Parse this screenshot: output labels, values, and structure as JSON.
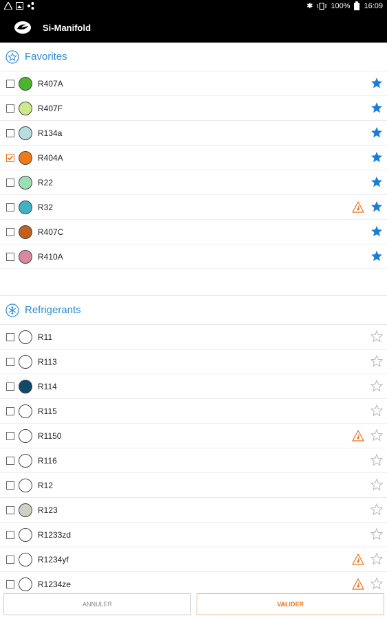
{
  "status": {
    "battery": "100%",
    "time": "16:09"
  },
  "app": {
    "title": "Si-Manifold"
  },
  "favorites": {
    "title": "Favorites",
    "items": [
      {
        "label": "R407A",
        "color": "#4db52d",
        "checked": false,
        "warning": false,
        "favorite": true
      },
      {
        "label": "R407F",
        "color": "#cde98b",
        "checked": false,
        "warning": false,
        "favorite": true
      },
      {
        "label": "R134a",
        "color": "#b9dce0",
        "checked": false,
        "warning": false,
        "favorite": true
      },
      {
        "label": "R404A",
        "color": "#ef7a17",
        "checked": true,
        "warning": false,
        "favorite": true
      },
      {
        "label": "R22",
        "color": "#9be0b2",
        "checked": false,
        "warning": false,
        "favorite": true
      },
      {
        "label": "R32",
        "color": "#40b2c8",
        "checked": false,
        "warning": true,
        "favorite": true
      },
      {
        "label": "R407C",
        "color": "#c0621e",
        "checked": false,
        "warning": false,
        "favorite": true
      },
      {
        "label": "R410A",
        "color": "#d98a9f",
        "checked": false,
        "warning": false,
        "favorite": true
      }
    ]
  },
  "refrigerants": {
    "title": "Refrigerants",
    "items": [
      {
        "label": "R11",
        "color": "#ffffff",
        "checked": false,
        "warning": false,
        "favorite": false
      },
      {
        "label": "R113",
        "color": "#ffffff",
        "checked": false,
        "warning": false,
        "favorite": false
      },
      {
        "label": "R114",
        "color": "#0f4a6b",
        "checked": false,
        "warning": false,
        "favorite": false
      },
      {
        "label": "R115",
        "color": "#ffffff",
        "checked": false,
        "warning": false,
        "favorite": false
      },
      {
        "label": "R1150",
        "color": "#ffffff",
        "checked": false,
        "warning": true,
        "favorite": false
      },
      {
        "label": "R116",
        "color": "#ffffff",
        "checked": false,
        "warning": false,
        "favorite": false
      },
      {
        "label": "R12",
        "color": "#ffffff",
        "checked": false,
        "warning": false,
        "favorite": false
      },
      {
        "label": "R123",
        "color": "#cfcfc6",
        "checked": false,
        "warning": false,
        "favorite": false
      },
      {
        "label": "R1233zd",
        "color": "#ffffff",
        "checked": false,
        "warning": false,
        "favorite": false
      },
      {
        "label": "R1234yf",
        "color": "#ffffff",
        "checked": false,
        "warning": true,
        "favorite": false
      },
      {
        "label": "R1234ze",
        "color": "#ffffff",
        "checked": false,
        "warning": true,
        "favorite": false
      }
    ]
  },
  "footer": {
    "cancel_label": "ANNULER",
    "validate_label": "VALIDER"
  },
  "icons": {
    "favorites_section": "star-circle-icon",
    "refrigerants_section": "snowflake-circle-icon",
    "warning": "flammable-warning-icon",
    "favorite_on": "star-filled-icon",
    "favorite_off": "star-outline-icon"
  },
  "colors": {
    "accent_blue": "#2b8bd0",
    "accent_orange": "#e8711a",
    "star_blue": "#1a7ed6",
    "star_empty": "#b5b5b5"
  }
}
